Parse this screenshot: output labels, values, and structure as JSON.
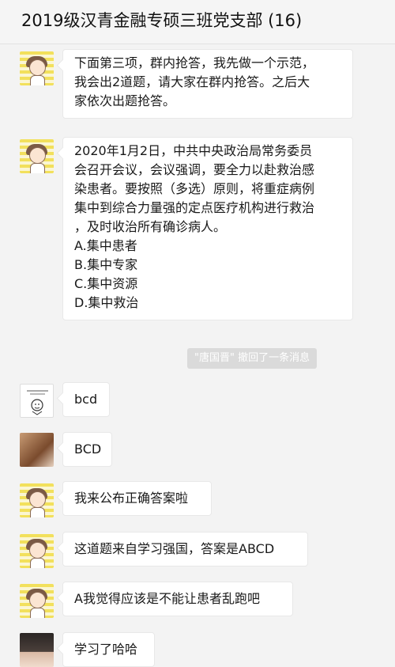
{
  "header": {
    "title": "2019级汉青金融专硕三班党支部 (16)"
  },
  "messages": [
    {
      "avatar": "cartoon-girl-yellow-stripes",
      "lines": [
        "下面第三项，群内抢答，我先做一个示范，",
        "我会出2道题，请大家在群内抢答。之后大",
        "家依次出题抢答。"
      ]
    },
    {
      "avatar": "cartoon-girl-yellow-stripes",
      "lines": [
        "2020年1月2日，中共中央政治局常务委员",
        "会召开会议，会议强调，要全力以赴救治感",
        "染患者。要按照（多选）原则，将重症病例",
        "集中到综合力量强的定点医疗机构进行救治",
        "，及时收治所有确诊病人。",
        "A.集中患者",
        "B.集中专家",
        "C.集中资源",
        "D.集中救治"
      ]
    },
    {
      "avatar": "sketch-meme",
      "text": "bcd"
    },
    {
      "avatar": "photo-hand",
      "text": "BCD"
    },
    {
      "avatar": "cartoon-girl-yellow-stripes",
      "text": "我来公布正确答案啦"
    },
    {
      "avatar": "cartoon-girl-yellow-stripes",
      "text": "这道题来自学习强国，答案是ABCD"
    },
    {
      "avatar": "cartoon-girl-yellow-stripes",
      "text": "A我觉得应该是不能让患者乱跑吧"
    },
    {
      "avatar": "photo-child",
      "text": "学习了哈哈"
    }
  ],
  "system_notice": "\"唐国晋\" 撤回了一条消息"
}
